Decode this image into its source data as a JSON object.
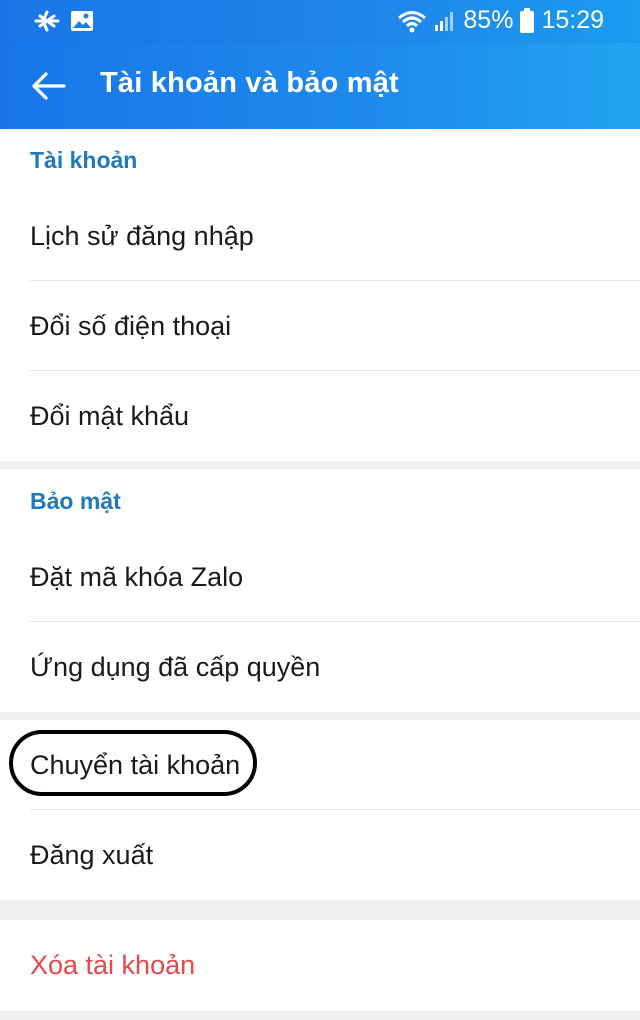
{
  "status_bar": {
    "battery": "85%",
    "time": "15:29",
    "icons": [
      "airplane-mode-icon",
      "image-icon",
      "wifi-icon",
      "signal-icon",
      "battery-icon"
    ]
  },
  "header": {
    "title": "Tài khoản và bảo mật",
    "back_icon": "arrow-left-icon"
  },
  "sections": {
    "account": {
      "header": "Tài khoản",
      "items": [
        "Lịch sử đăng nhập",
        "Đổi số điện thoại",
        "Đổi mật khẩu"
      ]
    },
    "security": {
      "header": "Bảo mật",
      "items": [
        "Đặt mã khóa Zalo",
        "Ứng dụng đã cấp quyền"
      ]
    },
    "session": {
      "items": [
        "Chuyển tài khoản",
        "Đăng xuất"
      ]
    },
    "danger": {
      "items": [
        "Xóa tài khoản"
      ]
    }
  },
  "colors": {
    "header_gradient_start": "#1876e9",
    "header_gradient_end": "#22a4f1",
    "section_header": "#1f79bb",
    "danger": "#e5484d",
    "background": "#f0f0f2"
  }
}
